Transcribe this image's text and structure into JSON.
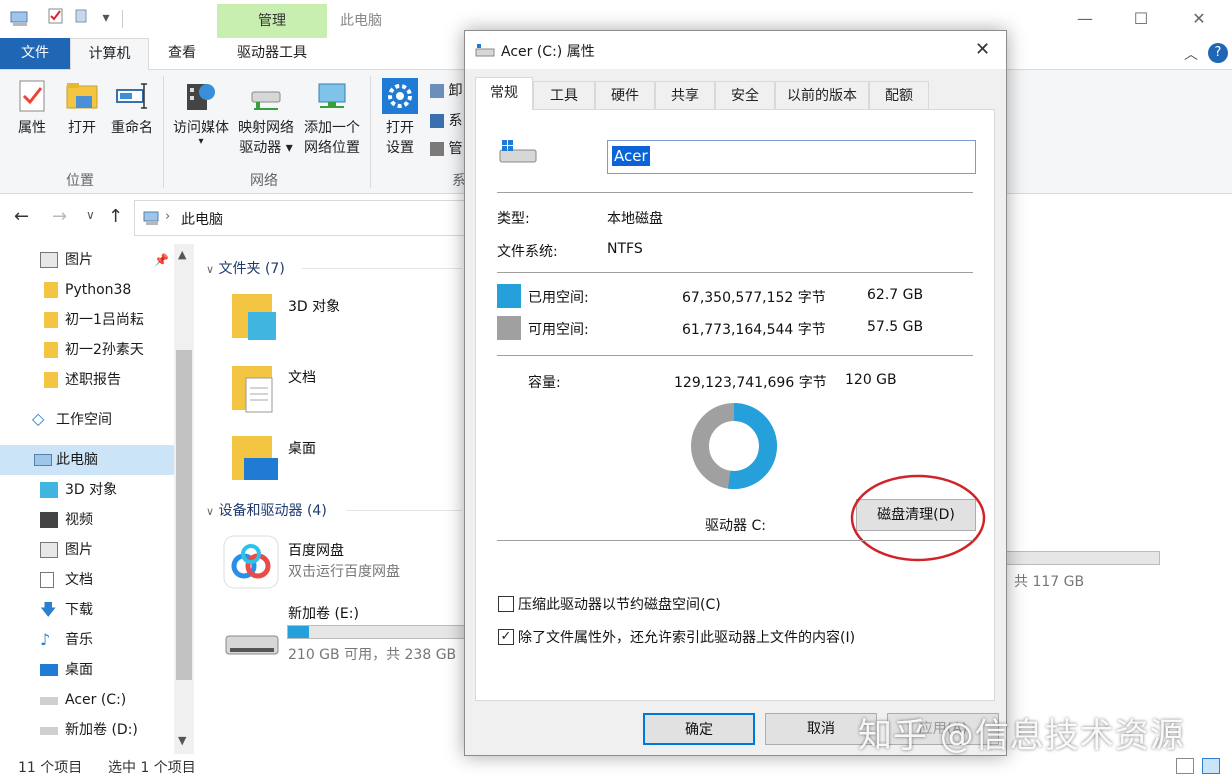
{
  "explorer": {
    "title": "此电脑",
    "context_tab_header": "管理",
    "ribbon_tabs": [
      "文件",
      "计算机",
      "查看",
      "驱动器工具"
    ],
    "ribbon": {
      "properties": "属性",
      "open": "打开",
      "rename": "重命名",
      "access_media": "访问媒体",
      "map_drive_l1": "映射网络",
      "map_drive_l2": "驱动器",
      "add_location_l1": "添加一个",
      "add_location_l2": "网络位置",
      "open_settings_l1": "打开",
      "open_settings_l2": "设置",
      "partial_1": "卸",
      "partial_2": "系",
      "partial_3": "管",
      "group_location": "位置",
      "group_network": "网络",
      "group_system_partial": "系"
    },
    "address": {
      "path": "此电脑"
    },
    "nav_items": [
      {
        "label": "图片",
        "icon": "pictures-icon"
      },
      {
        "label": "Python38",
        "icon": "folder-icon"
      },
      {
        "label": "初一1吕尚耘",
        "icon": "folder-icon"
      },
      {
        "label": "初一2孙素天",
        "icon": "folder-icon"
      },
      {
        "label": "述职报告",
        "icon": "folder-icon"
      },
      {
        "label": "工作空间",
        "icon": "workspace-icon"
      },
      {
        "label": "此电脑",
        "icon": "this-pc-icon"
      },
      {
        "label": "3D 对象",
        "icon": "3d-objects-icon"
      },
      {
        "label": "视频",
        "icon": "videos-icon"
      },
      {
        "label": "图片",
        "icon": "pictures-icon"
      },
      {
        "label": "文档",
        "icon": "documents-icon"
      },
      {
        "label": "下载",
        "icon": "downloads-icon"
      },
      {
        "label": "音乐",
        "icon": "music-icon"
      },
      {
        "label": "桌面",
        "icon": "desktop-icon"
      },
      {
        "label": "Acer (C:)",
        "icon": "drive-c-icon"
      },
      {
        "label": "新加卷 (D:)",
        "icon": "drive-d-icon"
      }
    ],
    "folders_header": "文件夹 (7)",
    "folders": [
      "3D 对象",
      "文档",
      "桌面"
    ],
    "devices_header": "设备和驱动器 (4)",
    "devices": {
      "baidu_name": "百度网盘",
      "baidu_sub": "双击运行百度网盘",
      "drive_e_name": "新加卷 (E:)",
      "drive_e_sub": "210 GB 可用，共 238 GB",
      "drive_e_used_fraction": 0.12,
      "partial_right_sub": "，共 117 GB"
    },
    "status": {
      "items": "11 个项目",
      "selected": "选中 1 个项目"
    }
  },
  "dialog": {
    "title": "Acer (C:) 属性",
    "tabs": [
      "常规",
      "工具",
      "硬件",
      "共享",
      "安全",
      "以前的版本",
      "配额"
    ],
    "drive_name_value": "Acer",
    "type_label": "类型:",
    "type_value": "本地磁盘",
    "fs_label": "文件系统:",
    "fs_value": "NTFS",
    "used_label": "已用空间:",
    "used_bytes": "67,350,577,152 字节",
    "used_gb": "62.7 GB",
    "free_label": "可用空间:",
    "free_bytes": "61,773,164,544 字节",
    "free_gb": "57.5 GB",
    "capacity_label": "容量:",
    "capacity_bytes": "129,123,741,696 字节",
    "capacity_gb": "120 GB",
    "drive_label": "驱动器 C:",
    "cleanup_button": "磁盘清理(D)",
    "compress_label": "压缩此驱动器以节约磁盘空间(C)",
    "compress_checked": false,
    "index_label": "除了文件属性外，还允许索引此驱动器上文件的内容(I)",
    "index_checked": true,
    "ok_button": "确定",
    "cancel_button": "取消",
    "apply_button": "应用(A)",
    "used_fraction": 0.5216,
    "colors": {
      "used": "#26a0da",
      "free": "#a0a0a0"
    }
  },
  "watermark": "知乎 @信息技术资源"
}
